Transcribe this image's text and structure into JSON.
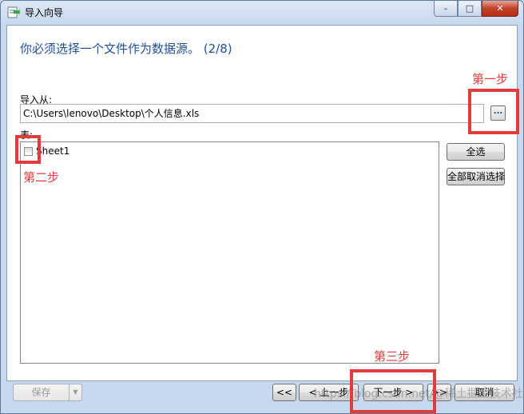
{
  "window": {
    "title": "导入向导",
    "controls": {
      "minimize": "–",
      "maximize": "□",
      "close": "✕"
    }
  },
  "wizard": {
    "heading": "你必须选择一个文件作为数据源。 (2/8)",
    "import_from_label": "导入从:",
    "file_path": "C:\\Users\\lenovo\\Desktop\\个人信息.xls",
    "browse_label": "...",
    "table_label": "表:",
    "sheets": [
      {
        "name": "Sheet1",
        "checked": false
      }
    ],
    "select_all": "全选",
    "deselect_all": "全部取消选择"
  },
  "footer": {
    "save": "保存",
    "first": "<<",
    "prev": "< 上一步",
    "next": "下一步 >",
    "last": ">>",
    "cancel": "取消"
  },
  "annotations": {
    "step1": "第一步",
    "step2": "第二步",
    "step3": "第三步",
    "color": "#e23b3b"
  },
  "watermark": "https://blog.csdn.net/@稀土掘金技术社区"
}
